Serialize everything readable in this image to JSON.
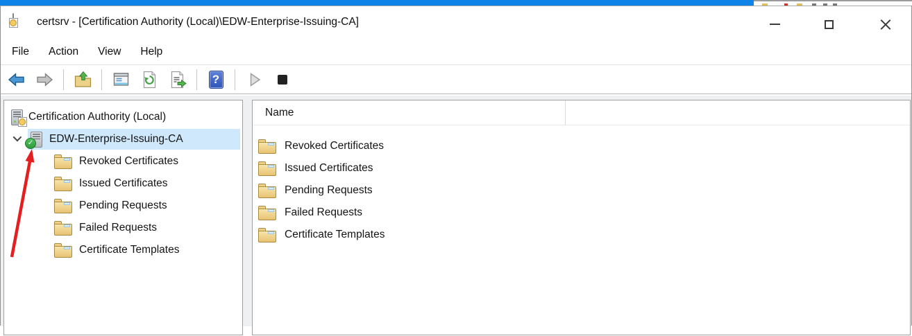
{
  "window": {
    "title": "certsrv - [Certification Authority (Local)\\EDW-Enterprise-Issuing-CA]"
  },
  "menu": {
    "items": [
      {
        "label": "File"
      },
      {
        "label": "Action"
      },
      {
        "label": "View"
      },
      {
        "label": "Help"
      }
    ]
  },
  "toolbar": {
    "buttons": [
      {
        "icon": "back-arrow-icon"
      },
      {
        "icon": "forward-arrow-icon"
      },
      {
        "icon": "up-one-level-icon"
      },
      {
        "icon": "show-console-tree-icon"
      },
      {
        "icon": "refresh-icon"
      },
      {
        "icon": "export-list-icon"
      },
      {
        "icon": "help-icon"
      },
      {
        "icon": "start-service-icon"
      },
      {
        "icon": "stop-service-icon"
      }
    ]
  },
  "icons": {
    "help_glyph": "?",
    "check_glyph": "✓"
  },
  "tree": {
    "root": {
      "label": "Certification Authority (Local)"
    },
    "ca": {
      "label": "EDW-Enterprise-Issuing-CA",
      "selected": true,
      "status": "running",
      "expanded": true
    },
    "children": [
      {
        "label": "Revoked Certificates"
      },
      {
        "label": "Issued Certificates"
      },
      {
        "label": "Pending Requests"
      },
      {
        "label": "Failed Requests"
      },
      {
        "label": "Certificate Templates"
      }
    ]
  },
  "list": {
    "columns": [
      {
        "label": "Name"
      }
    ],
    "items": [
      {
        "label": "Revoked Certificates"
      },
      {
        "label": "Issued Certificates"
      },
      {
        "label": "Pending Requests"
      },
      {
        "label": "Failed Requests"
      },
      {
        "label": "Certificate Templates"
      }
    ]
  },
  "annotation": {
    "description": "red arrow pointing to CA running-status check icon"
  },
  "colors": {
    "selection": "#cfe8fb",
    "accent_blue_strip": "#0f83e8",
    "arrow_red": "#e51f1f",
    "folder": "#eed28a",
    "status_green": "#3cb043"
  }
}
